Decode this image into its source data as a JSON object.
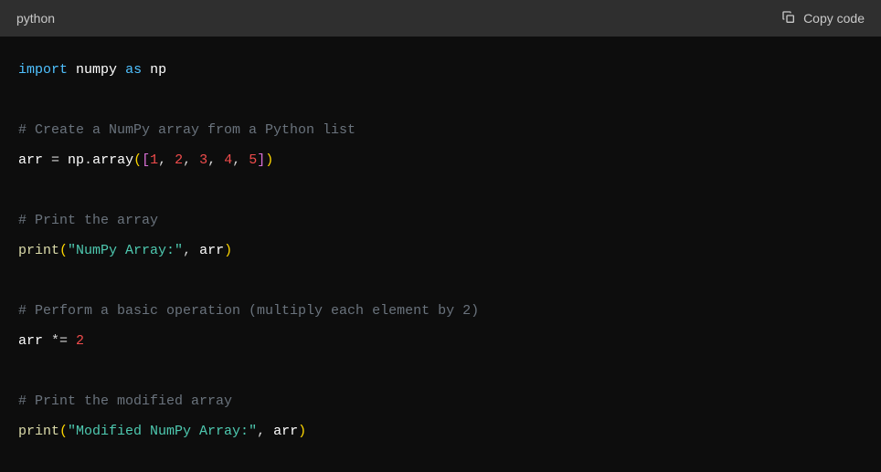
{
  "header": {
    "language": "python",
    "copy_label": "Copy code"
  },
  "code": {
    "l1_import": "import",
    "l1_module": "numpy",
    "l1_as": "as",
    "l1_alias": "np",
    "l2_comment": "# Create a NumPy array from a Python list",
    "l3_var": "arr",
    "l3_eq": " = ",
    "l3_np": "np",
    "l3_dot": ".",
    "l3_array": "array",
    "l3_lparen": "(",
    "l3_lbracket": "[",
    "l3_n1": "1",
    "l3_c1": ", ",
    "l3_n2": "2",
    "l3_c2": ", ",
    "l3_n3": "3",
    "l3_c3": ", ",
    "l3_n4": "4",
    "l3_c4": ", ",
    "l3_n5": "5",
    "l3_rbracket": "]",
    "l3_rparen": ")",
    "l4_comment": "# Print the array",
    "l5_print": "print",
    "l5_lparen": "(",
    "l5_str": "\"NumPy Array:\"",
    "l5_comma": ", ",
    "l5_arr": "arr",
    "l5_rparen": ")",
    "l6_comment": "# Perform a basic operation (multiply each element by 2)",
    "l7_arr": "arr",
    "l7_op": " *= ",
    "l7_n": "2",
    "l8_comment": "# Print the modified array",
    "l9_print": "print",
    "l9_lparen": "(",
    "l9_str": "\"Modified NumPy Array:\"",
    "l9_comma": ", ",
    "l9_arr": "arr",
    "l9_rparen": ")"
  }
}
